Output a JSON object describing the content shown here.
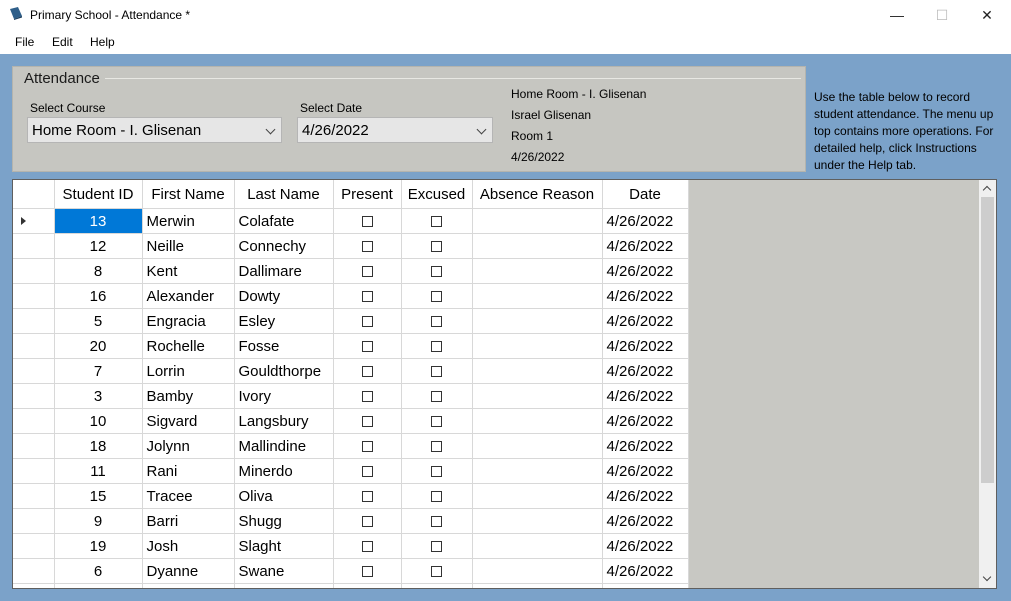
{
  "window": {
    "title": "Primary School - Attendance *",
    "minimize": "—",
    "maximize": "☐",
    "close": "✕"
  },
  "menu": [
    "File",
    "Edit",
    "Help"
  ],
  "attendance": {
    "group_title": "Attendance",
    "course_label": "Select Course",
    "course_value": "Home Room - I. Glisenan",
    "date_label": "Select Date",
    "date_value": "4/26/2022",
    "info": [
      "Home Room - I. Glisenan",
      "Israel Glisenan",
      "Room 1",
      "4/26/2022"
    ]
  },
  "help_text": "Use the table below to record student attendance. The menu up top contains more operations. For detailed help, click Instructions under the Help tab.",
  "table": {
    "columns": [
      "Student ID",
      "First Name",
      "Last Name",
      "Present",
      "Excused",
      "Absence Reason",
      "Date"
    ],
    "rows": [
      {
        "id": "13",
        "first": "Merwin",
        "last": "Colafate",
        "present": false,
        "excused": false,
        "reason": "",
        "date": "4/26/2022"
      },
      {
        "id": "12",
        "first": "Neille",
        "last": "Connechy",
        "present": false,
        "excused": false,
        "reason": "",
        "date": "4/26/2022"
      },
      {
        "id": "8",
        "first": "Kent",
        "last": "Dallimare",
        "present": false,
        "excused": false,
        "reason": "",
        "date": "4/26/2022"
      },
      {
        "id": "16",
        "first": "Alexander",
        "last": "Dowty",
        "present": false,
        "excused": false,
        "reason": "",
        "date": "4/26/2022"
      },
      {
        "id": "5",
        "first": "Engracia",
        "last": "Esley",
        "present": false,
        "excused": false,
        "reason": "",
        "date": "4/26/2022"
      },
      {
        "id": "20",
        "first": "Rochelle",
        "last": "Fosse",
        "present": false,
        "excused": false,
        "reason": "",
        "date": "4/26/2022"
      },
      {
        "id": "7",
        "first": "Lorrin",
        "last": "Gouldthorpe",
        "present": false,
        "excused": false,
        "reason": "",
        "date": "4/26/2022"
      },
      {
        "id": "3",
        "first": "Bamby",
        "last": "Ivory",
        "present": false,
        "excused": false,
        "reason": "",
        "date": "4/26/2022"
      },
      {
        "id": "10",
        "first": "Sigvard",
        "last": "Langsbury",
        "present": false,
        "excused": false,
        "reason": "",
        "date": "4/26/2022"
      },
      {
        "id": "18",
        "first": "Jolynn",
        "last": "Mallindine",
        "present": false,
        "excused": false,
        "reason": "",
        "date": "4/26/2022"
      },
      {
        "id": "11",
        "first": "Rani",
        "last": "Minerdo",
        "present": false,
        "excused": false,
        "reason": "",
        "date": "4/26/2022"
      },
      {
        "id": "15",
        "first": "Tracee",
        "last": "Oliva",
        "present": false,
        "excused": false,
        "reason": "",
        "date": "4/26/2022"
      },
      {
        "id": "9",
        "first": "Barri",
        "last": "Shugg",
        "present": false,
        "excused": false,
        "reason": "",
        "date": "4/26/2022"
      },
      {
        "id": "19",
        "first": "Josh",
        "last": "Slaght",
        "present": false,
        "excused": false,
        "reason": "",
        "date": "4/26/2022"
      },
      {
        "id": "6",
        "first": "Dyanne",
        "last": "Swane",
        "present": false,
        "excused": false,
        "reason": "",
        "date": "4/26/2022"
      },
      {
        "id": "",
        "first": "",
        "last": "",
        "present": false,
        "excused": false,
        "reason": "",
        "date": ""
      }
    ],
    "selected_row": 0
  },
  "colors": {
    "window_bg": "#7ba2c9",
    "panel_bg": "#c6c6c1",
    "selection": "#0078d7"
  }
}
